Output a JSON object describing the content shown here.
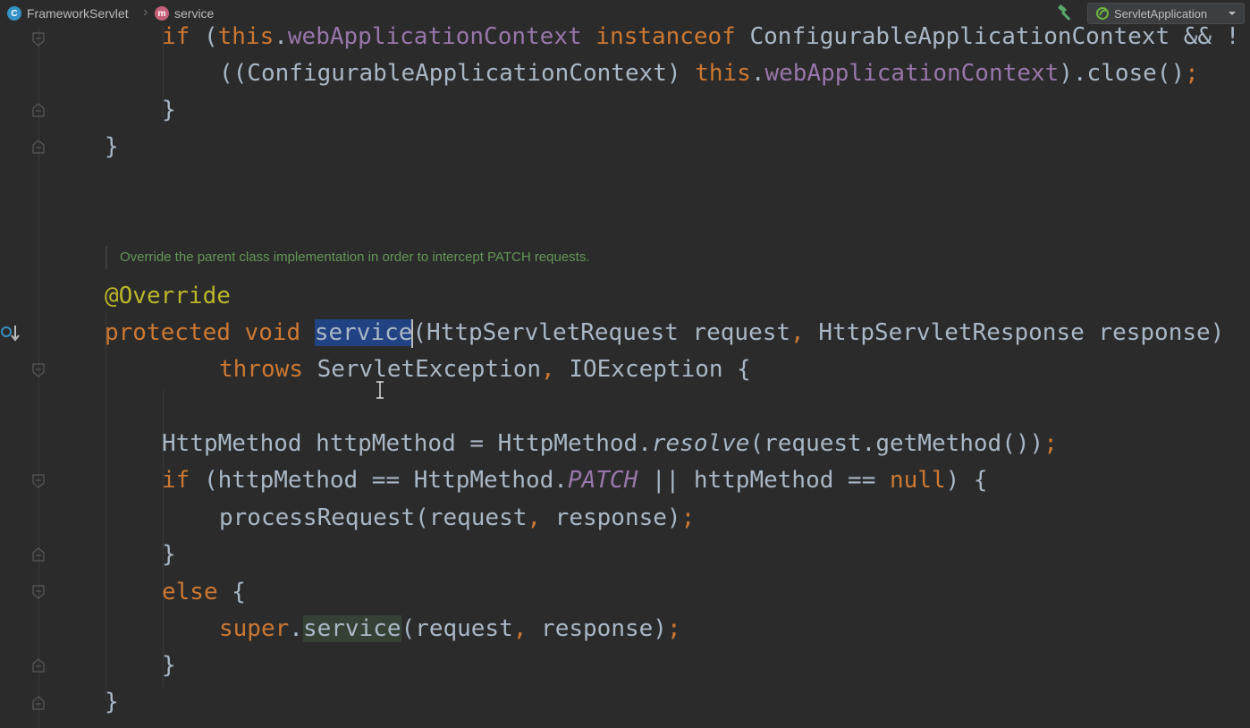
{
  "breadcrumb": {
    "class_icon": "class-icon",
    "class_name": "FrameworkServlet",
    "method_icon": "method-icon",
    "method_name": "service"
  },
  "toolbar": {
    "build_icon": "hammer-icon",
    "run_config": "ServletApplication"
  },
  "editor": {
    "doc_comment": "Override the parent class implementation in order to intercept PATCH requests.",
    "code": {
      "l1": {
        "kw_if": "if",
        "p1": " (",
        "kw_this": "this",
        "dot": ".",
        "fld": "webApplicationContext",
        "sp": " ",
        "kw_inst": "instanceof",
        "rest": " ConfigurableApplicationContext && !"
      },
      "l2": {
        "p1": "((ConfigurableApplicationContext) ",
        "kw_this": "this",
        "dot": ".",
        "fld": "webApplicationContext",
        "rest": ").close()",
        "semi": ";"
      },
      "l3": "}",
      "l4": "}",
      "l5": "@Override",
      "l6": {
        "kw_protected": "protected",
        "sp1": " ",
        "kw_void": "void",
        "sp2": " ",
        "name": "service",
        "p1": "(HttpServletRequest request",
        "comma": ",",
        "p2": " HttpServletResponse response)"
      },
      "l7": {
        "kw_throws": "throws",
        "p1": " ServletException",
        "comma": ",",
        "p2": " IOException {"
      },
      "l8": {
        "p1": "HttpMethod httpMethod = HttpMethod.",
        "resolve": "resolve",
        "p2": "(request.getMethod())",
        "semi": ";"
      },
      "l9": {
        "kw_if": "if",
        "p1": " (httpMethod == HttpMethod.",
        "patch": "PATCH",
        "p2": " || httpMethod == ",
        "kw_null": "null",
        "p3": ") {"
      },
      "l10": {
        "p1": "processRequest(request",
        "comma": ",",
        "p2": " response)",
        "semi": ";"
      },
      "l11": "}",
      "l12": {
        "kw_else": "else",
        "p1": " {"
      },
      "l13": {
        "kw_super": "super",
        "dot": ".",
        "call": "service",
        "p1": "(request",
        "comma": ",",
        "p2": " response)",
        "semi": ";"
      },
      "l14": "}",
      "l15": "}"
    }
  },
  "colors": {
    "background": "#2b2b2b",
    "keyword": "#cc7832",
    "field": "#9876aa",
    "annotation": "#bbb529",
    "doc": "#629755",
    "selection": "#214283"
  }
}
